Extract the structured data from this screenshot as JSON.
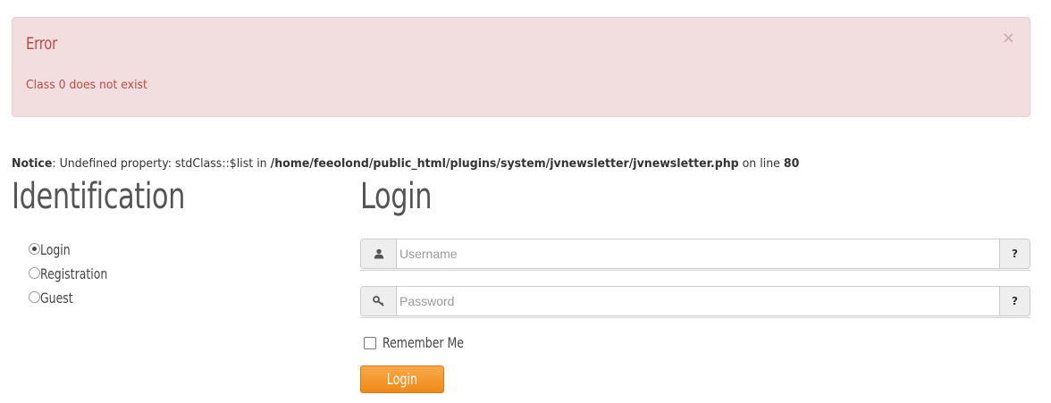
{
  "alert": {
    "heading": "Error",
    "message": "Class 0 does not exist",
    "close_symbol": "×",
    "background": "#f2dede",
    "text_color": "#b94a48"
  },
  "notice": {
    "label": "Notice",
    "text": ": Undefined property: stdClass::$list in ",
    "path": "/home/feeolond/public_html/plugins/system/jvnewsletter/jvnewsletter.php",
    "line_text": " on line ",
    "line_number": "80"
  },
  "identification": {
    "title": "Identification",
    "options": [
      {
        "label": "Login",
        "checked": true
      },
      {
        "label": "Registration",
        "checked": false
      },
      {
        "label": "Guest",
        "checked": false
      }
    ]
  },
  "login": {
    "title": "Login",
    "username": {
      "placeholder": "Username",
      "value": "",
      "icon": "user-icon",
      "help": "?"
    },
    "password": {
      "placeholder": "Password",
      "value": "",
      "icon": "key-icon",
      "help": "?"
    },
    "remember_label": "Remember Me",
    "remember_checked": false,
    "button_label": "Login",
    "button_color": "#f39a2e"
  }
}
